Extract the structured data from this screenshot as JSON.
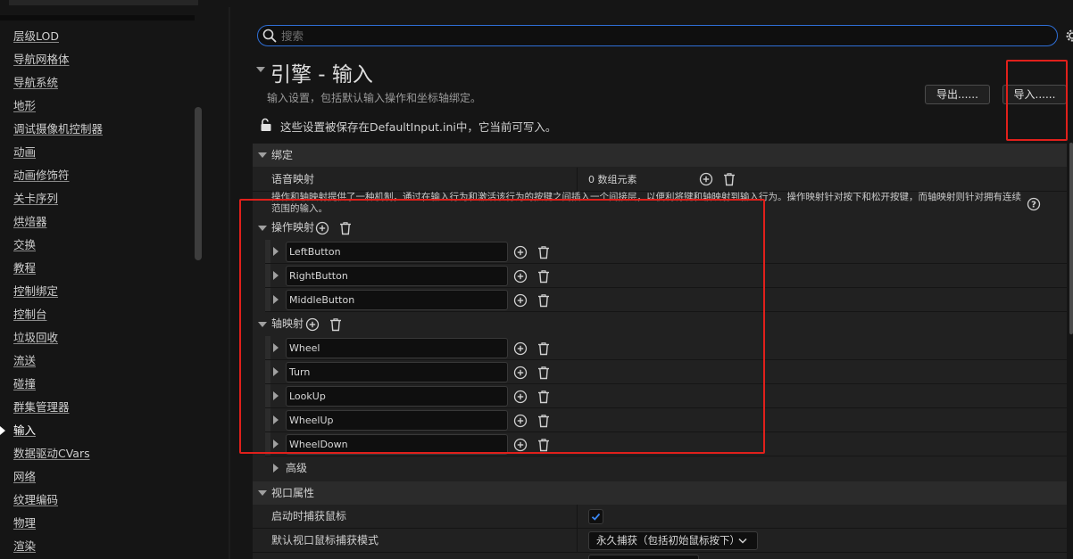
{
  "sidebar": {
    "items": [
      {
        "label": "层级LOD",
        "active": false
      },
      {
        "label": "导航网格体",
        "active": false
      },
      {
        "label": "导航系统",
        "active": false
      },
      {
        "label": "地形",
        "active": false
      },
      {
        "label": "调试摄像机控制器",
        "active": false
      },
      {
        "label": "动画",
        "active": false
      },
      {
        "label": "动画修饰符",
        "active": false
      },
      {
        "label": "关卡序列",
        "active": false
      },
      {
        "label": "烘焙器",
        "active": false
      },
      {
        "label": "交换",
        "active": false
      },
      {
        "label": "教程",
        "active": false
      },
      {
        "label": "控制绑定",
        "active": false
      },
      {
        "label": "控制台",
        "active": false
      },
      {
        "label": "垃圾回收",
        "active": false
      },
      {
        "label": "流送",
        "active": false
      },
      {
        "label": "碰撞",
        "active": false
      },
      {
        "label": "群集管理器",
        "active": false
      },
      {
        "label": "输入",
        "active": true
      },
      {
        "label": "数据驱动CVars",
        "active": false
      },
      {
        "label": "网络",
        "active": false
      },
      {
        "label": "纹理编码",
        "active": false
      },
      {
        "label": "物理",
        "active": false
      },
      {
        "label": "渲染",
        "active": false
      }
    ]
  },
  "search": {
    "placeholder": "搜索",
    "value": ""
  },
  "header": {
    "title": "引擎 - 输入",
    "description": "输入设置，包括默认输入操作和坐标轴绑定。",
    "export_label": "导出......",
    "import_label": "导入......",
    "save_note": "这些设置被保存在DefaultInput.ini中，它当前可写入。"
  },
  "bindings": {
    "category": "绑定",
    "speech_label": "语音映射",
    "speech_value": "0 数组元素",
    "description": "操作和轴映射提供了一种机制，通过在输入行为和激活该行为的按键之间插入一个间接层，以便利将键和轴映射到输入行为。操作映射针对按下和松开按键，而轴映射则针对拥有连续范围的输入。",
    "action_label": "操作映射",
    "actions": [
      "LeftButton",
      "RightButton",
      "MiddleButton"
    ],
    "axis_label": "轴映射",
    "axes": [
      "Wheel",
      "Turn",
      "LookUp",
      "WheelUp",
      "WheelDown"
    ],
    "advanced_label": "高级"
  },
  "viewport": {
    "category": "视口属性",
    "capture_label": "启动时捕获鼠标",
    "capture_checked": true,
    "mode_label": "默认视口鼠标捕获模式",
    "mode_value": "永久捕获（包括初始鼠标按下）"
  },
  "colors": {
    "accent": "#2f6fd6",
    "highlight": "#e0201b",
    "background": "#151515",
    "panel": "#212121"
  },
  "icons": [
    "search-icon",
    "gear-icon",
    "lock-icon",
    "add-icon",
    "trash-icon",
    "help-icon",
    "checkmark-icon",
    "chevron-down-icon"
  ]
}
